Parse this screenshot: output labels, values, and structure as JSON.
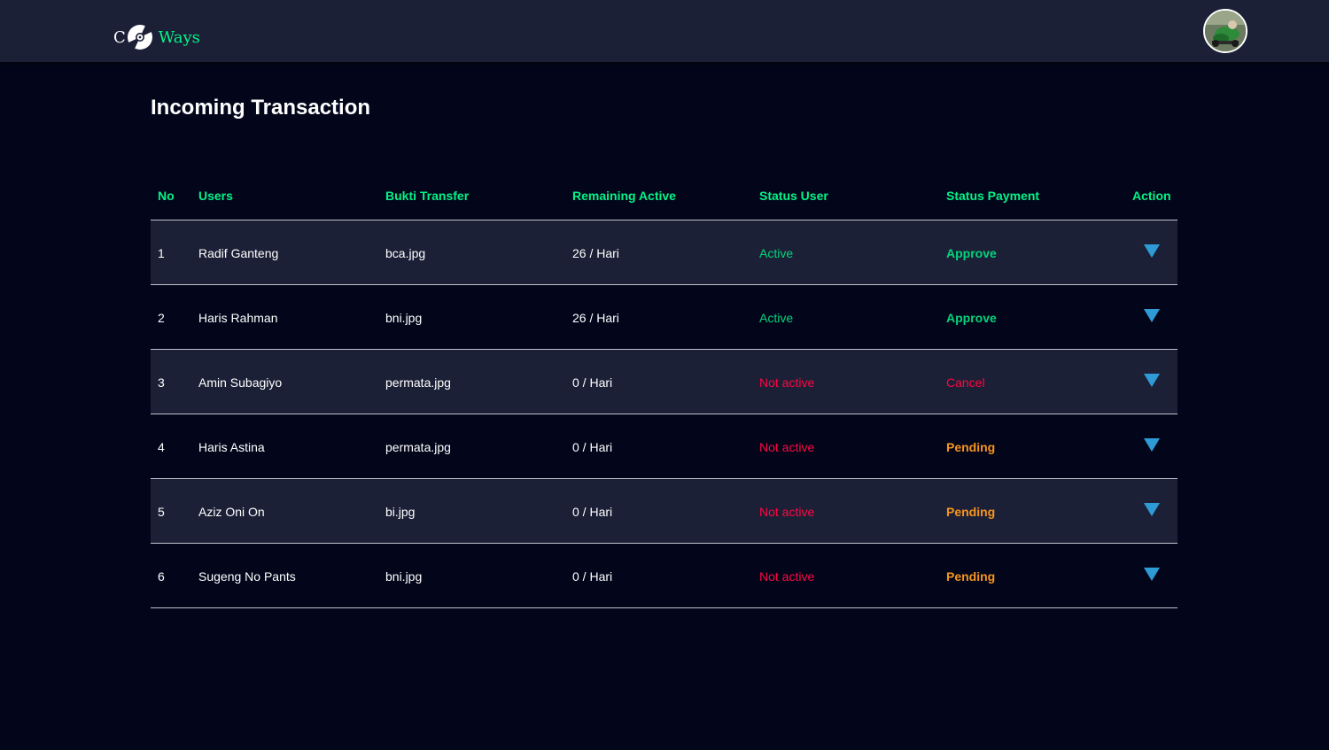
{
  "brand": {
    "prefix": "C",
    "name": "Ways",
    "accent_color": "#03f387"
  },
  "page": {
    "title": "Incoming Transaction"
  },
  "table": {
    "headers": [
      "No",
      "Users",
      "Bukti Transfer",
      "Remaining Active",
      "Status User",
      "Status Payment",
      "Action"
    ],
    "rows": [
      {
        "no": "1",
        "user": "Radif Ganteng",
        "bukti": "bca.jpg",
        "remaining": "26 / Hari",
        "status_user": "Active",
        "status_payment": "Approve"
      },
      {
        "no": "2",
        "user": "Haris Rahman",
        "bukti": "bni.jpg",
        "remaining": "26 / Hari",
        "status_user": "Active",
        "status_payment": "Approve"
      },
      {
        "no": "3",
        "user": "Amin Subagiyo",
        "bukti": "permata.jpg",
        "remaining": "0 / Hari",
        "status_user": "Not active",
        "status_payment": "Cancel"
      },
      {
        "no": "4",
        "user": "Haris Astina",
        "bukti": "permata.jpg",
        "remaining": "0 / Hari",
        "status_user": "Not active",
        "status_payment": "Pending"
      },
      {
        "no": "5",
        "user": "Aziz Oni On",
        "bukti": "bi.jpg",
        "remaining": "0 / Hari",
        "status_user": "Not active",
        "status_payment": "Pending"
      },
      {
        "no": "6",
        "user": "Sugeng No Pants",
        "bukti": "bni.jpg",
        "remaining": "0 / Hari",
        "status_user": "Not active",
        "status_payment": "Pending"
      }
    ],
    "action_icon": "triangle-down-icon"
  },
  "colors": {
    "background": "#03061b",
    "navbar": "#1c2036",
    "active": "#03d47c",
    "inactive": "#ff0742",
    "pending": "#f7941e",
    "action_arrow": "#2f9bd6"
  }
}
